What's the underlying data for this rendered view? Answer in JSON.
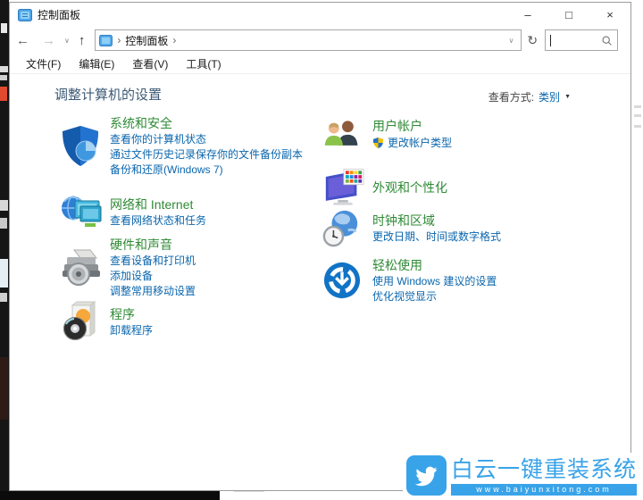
{
  "colors": {
    "heading_green": "#2f8a35",
    "link_blue": "#0a66ad",
    "header_blue": "#3d5a76",
    "watermark_blue": "#38a3e8",
    "menu_text": "#1a1a1a",
    "window_border": "#9c9c9c"
  },
  "window": {
    "title": "控制面板",
    "controls": {
      "minimize": "–",
      "maximize": "□",
      "close": "×"
    }
  },
  "icons": {
    "back": "←",
    "forward": "→",
    "up": "↑",
    "dropdown": "∨",
    "refresh": "↻",
    "breadcrumb_separator": "›",
    "caret_down": "▼"
  },
  "toolbar": {
    "breadcrumb": {
      "root_label": "控制面板"
    },
    "search": {
      "value": ""
    }
  },
  "menu": {
    "items": [
      {
        "label": "文件(F)"
      },
      {
        "label": "编辑(E)"
      },
      {
        "label": "查看(V)"
      },
      {
        "label": "工具(T)"
      }
    ]
  },
  "header": {
    "title": "调整计算机的设置",
    "view_by_label": "查看方式:",
    "view_by_value": "类别"
  },
  "categories": {
    "left": [
      {
        "title": "系统和安全",
        "icon": "shield-icon",
        "links": [
          "查看你的计算机状态",
          "通过文件历史记录保存你的文件备份副本",
          "备份和还原(Windows 7)"
        ]
      },
      {
        "title": "网络和 Internet",
        "icon": "network-icon",
        "links": [
          "查看网络状态和任务"
        ]
      },
      {
        "title": "硬件和声音",
        "icon": "hardware-sound-icon",
        "links": [
          "查看设备和打印机",
          "添加设备",
          "调整常用移动设置"
        ]
      },
      {
        "title": "程序",
        "icon": "programs-icon",
        "links": [
          "卸载程序"
        ]
      }
    ],
    "right": [
      {
        "title": "用户帐户",
        "icon": "user-accounts-icon",
        "links": [
          "更改帐户类型"
        ]
      },
      {
        "title": "外观和个性化",
        "icon": "personalization-icon",
        "links": []
      },
      {
        "title": "时钟和区域",
        "icon": "clock-region-icon",
        "links": [
          "更改日期、时间或数字格式"
        ]
      },
      {
        "title": "轻松使用",
        "icon": "ease-of-access-icon",
        "links": [
          "使用 Windows 建议的设置",
          "优化视觉显示"
        ]
      }
    ]
  },
  "watermark": {
    "brand": "白云一键重装系统",
    "url": "www.baiyunxitong.com"
  }
}
